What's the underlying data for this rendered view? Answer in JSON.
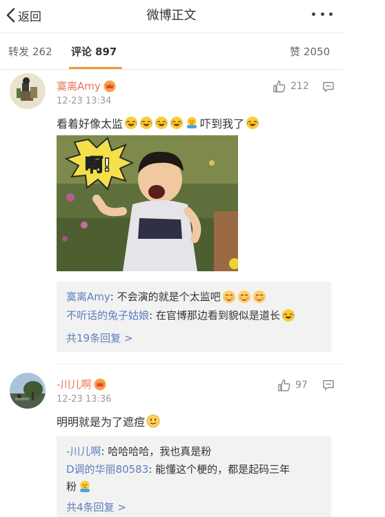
{
  "header": {
    "back_label": "返回",
    "title": "微博正文"
  },
  "tabs": [
    {
      "label": "转发",
      "count": "262"
    },
    {
      "label": "评论",
      "count": "897"
    },
    {
      "label": "赞",
      "count": "2050"
    }
  ],
  "comments": [
    {
      "user": "寞离Amy",
      "time": "12-23 13:34",
      "likes": "212",
      "text_parts": [
        "看着好像太监",
        "吓到我了"
      ],
      "photo_caption": "啊!",
      "replies": [
        {
          "user": "寞离Amy",
          "text": "不会演的就是个太监吧"
        },
        {
          "user": "不听话的兔子姑娘",
          "text": "在官博那边看到貌似是道长"
        }
      ],
      "more_label": "共19条回复 >"
    },
    {
      "user": "-川儿啊",
      "time": "12-23 13:36",
      "likes": "97",
      "text": "明明就是为了遮痘",
      "replies": [
        {
          "user": "-川儿啊",
          "text": "哈哈哈哈，我也真是粉"
        },
        {
          "user": "D调的华丽80583",
          "text": "能懂这个梗的，都是起码三年",
          "text2": "粉"
        }
      ],
      "more_label": "共4条回复 >"
    }
  ],
  "colors": {
    "name": "#eb7350",
    "link": "#5b7fbd",
    "tab_accent": "#f29a34"
  },
  "icons": [
    "back-chevron-icon",
    "more-dots-icon",
    "crown-badge-icon",
    "thumbs-up-icon",
    "reply-comment-icon",
    "laugh-cry-emoji-icon",
    "shy-emoji-icon",
    "smile-emoji-icon",
    "sweat-emoji-icon"
  ]
}
